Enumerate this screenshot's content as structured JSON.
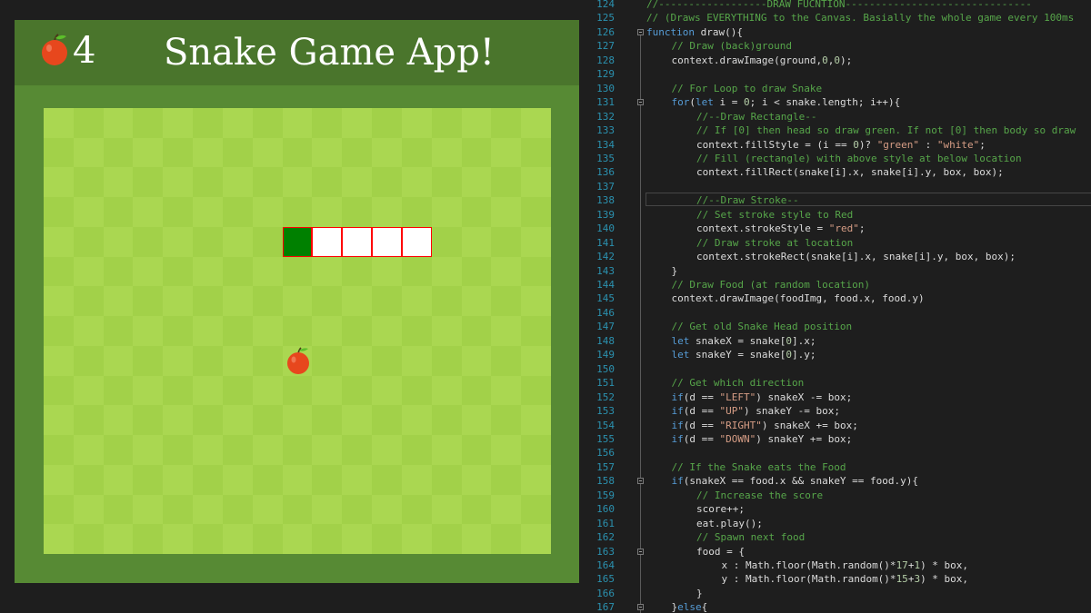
{
  "game": {
    "score": "4",
    "title": "Snake Game App!",
    "colors": {
      "header": "#4a752c",
      "frame": "#578a34",
      "grass_light": "#aad751",
      "grass_dark": "#a2d149",
      "snake_head": "green",
      "snake_body": "white",
      "snake_stroke": "red",
      "apple": "#e7471d"
    },
    "icons": {
      "score": "apple-icon",
      "food": "apple-icon"
    },
    "grid": {
      "cols": 17,
      "rows": 15
    },
    "snake": [
      {
        "col": 8,
        "row": 4
      },
      {
        "col": 9,
        "row": 4
      },
      {
        "col": 10,
        "row": 4
      },
      {
        "col": 11,
        "row": 4
      },
      {
        "col": 12,
        "row": 4
      }
    ],
    "food": {
      "col": 8,
      "row": 8
    }
  },
  "editor": {
    "colors": {
      "background": "#1e1e1e",
      "line_number": "#2b91af",
      "comment": "#57a64a",
      "keyword": "#569cd6",
      "string": "#d69d85",
      "number": "#b5cea8",
      "plain": "#dcdcdc"
    },
    "lines": [
      {
        "n": "124",
        "indent": 0,
        "tokens": [
          [
            "c",
            "//------------------DRAW FUCNTION-------------------------------"
          ]
        ]
      },
      {
        "n": "125",
        "indent": 0,
        "tokens": [
          [
            "c",
            "// (Draws EVERYTHING to the Canvas. Basially the whole game every 100ms"
          ]
        ]
      },
      {
        "n": "126",
        "indent": 0,
        "fold": true,
        "tokens": [
          [
            "k",
            "function"
          ],
          [
            "p",
            " draw(){"
          ]
        ]
      },
      {
        "n": "127",
        "indent": 1,
        "tokens": [
          [
            "c",
            "// Draw (back)ground"
          ]
        ]
      },
      {
        "n": "128",
        "indent": 1,
        "tokens": [
          [
            "p",
            "context.drawImage(ground,"
          ],
          [
            "n",
            "0"
          ],
          [
            "p",
            ","
          ],
          [
            "n",
            "0"
          ],
          [
            "p",
            ");"
          ]
        ]
      },
      {
        "n": "129",
        "indent": 0,
        "tokens": []
      },
      {
        "n": "130",
        "indent": 1,
        "tokens": [
          [
            "c",
            "// For Loop to draw Snake"
          ]
        ]
      },
      {
        "n": "131",
        "indent": 1,
        "fold": true,
        "tokens": [
          [
            "k",
            "for"
          ],
          [
            "p",
            "("
          ],
          [
            "k",
            "let"
          ],
          [
            "p",
            " i = "
          ],
          [
            "n",
            "0"
          ],
          [
            "p",
            "; i < snake.length; i++){"
          ]
        ]
      },
      {
        "n": "132",
        "indent": 2,
        "tokens": [
          [
            "c",
            "//--Draw Rectangle--"
          ]
        ]
      },
      {
        "n": "133",
        "indent": 2,
        "tokens": [
          [
            "c",
            "// If [0] then head so draw green. If not [0] then body so draw"
          ]
        ]
      },
      {
        "n": "134",
        "indent": 2,
        "tokens": [
          [
            "p",
            "context.fillStyle = (i == "
          ],
          [
            "n",
            "0"
          ],
          [
            "p",
            ")? "
          ],
          [
            "s",
            "\"green\""
          ],
          [
            "p",
            " : "
          ],
          [
            "s",
            "\"white\""
          ],
          [
            "p",
            ";"
          ]
        ]
      },
      {
        "n": "135",
        "indent": 2,
        "tokens": [
          [
            "c",
            "// Fill (rectangle) with above style at below location"
          ]
        ]
      },
      {
        "n": "136",
        "indent": 2,
        "tokens": [
          [
            "p",
            "context.fillRect(snake[i].x, snake[i].y, box, box);"
          ]
        ]
      },
      {
        "n": "137",
        "indent": 0,
        "tokens": []
      },
      {
        "n": "138",
        "indent": 2,
        "tokens": [
          [
            "c",
            "//--Draw Stroke--"
          ]
        ]
      },
      {
        "n": "139",
        "indent": 2,
        "tokens": [
          [
            "c",
            "// Set stroke style to Red"
          ]
        ]
      },
      {
        "n": "140",
        "indent": 2,
        "tokens": [
          [
            "p",
            "context.strokeStyle = "
          ],
          [
            "s",
            "\"red\""
          ],
          [
            "p",
            ";"
          ]
        ]
      },
      {
        "n": "141",
        "indent": 2,
        "tokens": [
          [
            "c",
            "// Draw stroke at location"
          ]
        ]
      },
      {
        "n": "142",
        "indent": 2,
        "tokens": [
          [
            "p",
            "context.strokeRect(snake[i].x, snake[i].y, box, box);"
          ]
        ]
      },
      {
        "n": "143",
        "indent": 1,
        "tokens": [
          [
            "p",
            "}"
          ]
        ]
      },
      {
        "n": "144",
        "indent": 1,
        "tokens": [
          [
            "c",
            "// Draw Food (at random location)"
          ]
        ]
      },
      {
        "n": "145",
        "indent": 1,
        "tokens": [
          [
            "p",
            "context.drawImage(foodImg, food.x, food.y)"
          ]
        ]
      },
      {
        "n": "146",
        "indent": 0,
        "tokens": []
      },
      {
        "n": "147",
        "indent": 1,
        "tokens": [
          [
            "c",
            "// Get old Snake Head position"
          ]
        ]
      },
      {
        "n": "148",
        "indent": 1,
        "tokens": [
          [
            "k",
            "let"
          ],
          [
            "p",
            " snakeX = snake["
          ],
          [
            "n",
            "0"
          ],
          [
            "p",
            "].x;"
          ]
        ]
      },
      {
        "n": "149",
        "indent": 1,
        "tokens": [
          [
            "k",
            "let"
          ],
          [
            "p",
            " snakeY = snake["
          ],
          [
            "n",
            "0"
          ],
          [
            "p",
            "].y;"
          ]
        ]
      },
      {
        "n": "150",
        "indent": 0,
        "tokens": []
      },
      {
        "n": "151",
        "indent": 1,
        "tokens": [
          [
            "c",
            "// Get which direction"
          ]
        ]
      },
      {
        "n": "152",
        "indent": 1,
        "tokens": [
          [
            "k",
            "if"
          ],
          [
            "p",
            "(d == "
          ],
          [
            "s",
            "\"LEFT\""
          ],
          [
            "p",
            ") snakeX -= box;"
          ]
        ]
      },
      {
        "n": "153",
        "indent": 1,
        "tokens": [
          [
            "k",
            "if"
          ],
          [
            "p",
            "(d == "
          ],
          [
            "s",
            "\"UP\""
          ],
          [
            "p",
            ") snakeY -= box;"
          ]
        ]
      },
      {
        "n": "154",
        "indent": 1,
        "tokens": [
          [
            "k",
            "if"
          ],
          [
            "p",
            "(d == "
          ],
          [
            "s",
            "\"RIGHT\""
          ],
          [
            "p",
            ") snakeX += box;"
          ]
        ]
      },
      {
        "n": "155",
        "indent": 1,
        "tokens": [
          [
            "k",
            "if"
          ],
          [
            "p",
            "(d == "
          ],
          [
            "s",
            "\"DOWN\""
          ],
          [
            "p",
            ") snakeY += box;"
          ]
        ]
      },
      {
        "n": "156",
        "indent": 0,
        "tokens": []
      },
      {
        "n": "157",
        "indent": 1,
        "tokens": [
          [
            "c",
            "// If the Snake eats the Food"
          ]
        ]
      },
      {
        "n": "158",
        "indent": 1,
        "fold": true,
        "tokens": [
          [
            "k",
            "if"
          ],
          [
            "p",
            "(snakeX == food.x && snakeY == food.y){"
          ]
        ]
      },
      {
        "n": "159",
        "indent": 2,
        "tokens": [
          [
            "c",
            "// Increase the score"
          ]
        ]
      },
      {
        "n": "160",
        "indent": 2,
        "tokens": [
          [
            "p",
            "score++;"
          ]
        ]
      },
      {
        "n": "161",
        "indent": 2,
        "tokens": [
          [
            "p",
            "eat.play();"
          ]
        ]
      },
      {
        "n": "162",
        "indent": 2,
        "tokens": [
          [
            "c",
            "// Spawn next food"
          ]
        ]
      },
      {
        "n": "163",
        "indent": 2,
        "fold": true,
        "tokens": [
          [
            "p",
            "food = {"
          ]
        ]
      },
      {
        "n": "164",
        "indent": 3,
        "tokens": [
          [
            "p",
            "x : Math.floor(Math.random()*"
          ],
          [
            "n",
            "17"
          ],
          [
            "p",
            "+"
          ],
          [
            "n",
            "1"
          ],
          [
            "p",
            ") * box,"
          ]
        ]
      },
      {
        "n": "165",
        "indent": 3,
        "tokens": [
          [
            "p",
            "y : Math.floor(Math.random()*"
          ],
          [
            "n",
            "15"
          ],
          [
            "p",
            "+"
          ],
          [
            "n",
            "3"
          ],
          [
            "p",
            ") * box,"
          ]
        ]
      },
      {
        "n": "166",
        "indent": 2,
        "tokens": [
          [
            "p",
            "}"
          ]
        ]
      },
      {
        "n": "167",
        "indent": 1,
        "fold": true,
        "tokens": [
          [
            "p",
            "}"
          ],
          [
            "k",
            "else"
          ],
          [
            "p",
            "{"
          ]
        ]
      }
    ]
  }
}
